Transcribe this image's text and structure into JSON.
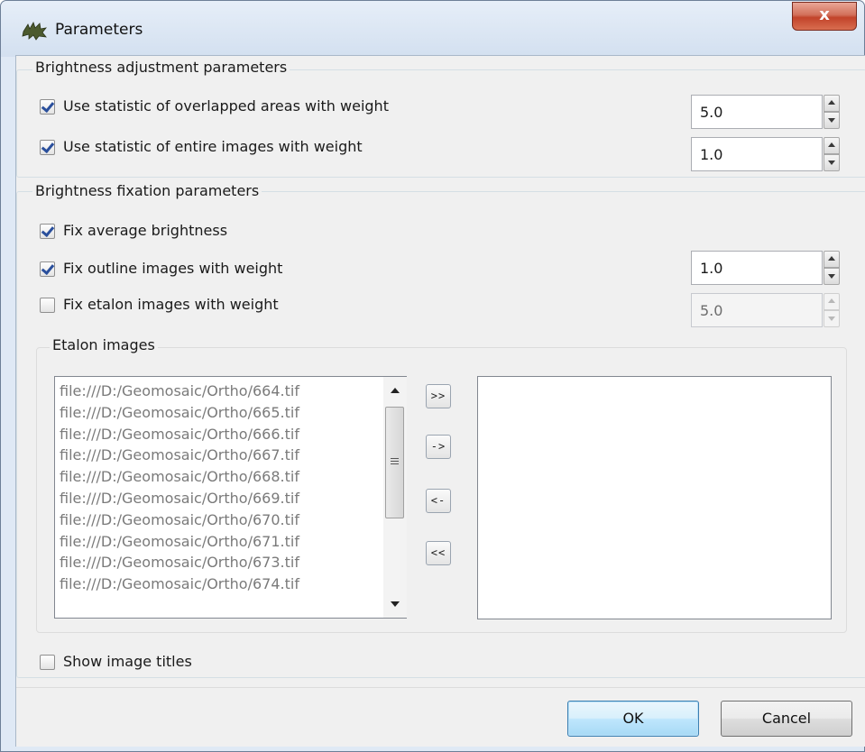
{
  "window": {
    "title": "Parameters",
    "close_glyph": "x",
    "icon": "app-leaf-icon"
  },
  "adjustment": {
    "legend": "Brightness adjustment parameters",
    "overlapped": {
      "label": "Use statistic of overlapped areas with weight",
      "checked": true,
      "value": "5.0"
    },
    "entire": {
      "label": "Use statistic of entire images with weight",
      "checked": true,
      "value": "1.0"
    }
  },
  "fixation": {
    "legend": "Brightness fixation parameters",
    "average": {
      "label": "Fix average brightness",
      "checked": true
    },
    "outline": {
      "label": "Fix outline images with weight",
      "checked": true,
      "value": "1.0"
    },
    "etalon": {
      "label": "Fix etalon images with weight",
      "checked": false,
      "value": "5.0",
      "disabled": true
    }
  },
  "etalon_images": {
    "legend": "Etalon images",
    "available": [
      "file:///D:/Geomosaic/Ortho/664.tif",
      "file:///D:/Geomosaic/Ortho/665.tif",
      "file:///D:/Geomosaic/Ortho/666.tif",
      "file:///D:/Geomosaic/Ortho/667.tif",
      "file:///D:/Geomosaic/Ortho/668.tif",
      "file:///D:/Geomosaic/Ortho/669.tif",
      "file:///D:/Geomosaic/Ortho/670.tif",
      "file:///D:/Geomosaic/Ortho/671.tif",
      "file:///D:/Geomosaic/Ortho/673.tif",
      "file:///D:/Geomosaic/Ortho/674.tif"
    ],
    "selected": [],
    "buttons": {
      "add_all": ">>",
      "add": "->",
      "remove": "<-",
      "remove_all": "<<"
    }
  },
  "show_titles": {
    "label": "Show image titles",
    "checked": false
  },
  "footer": {
    "ok": "OK",
    "cancel": "Cancel"
  }
}
